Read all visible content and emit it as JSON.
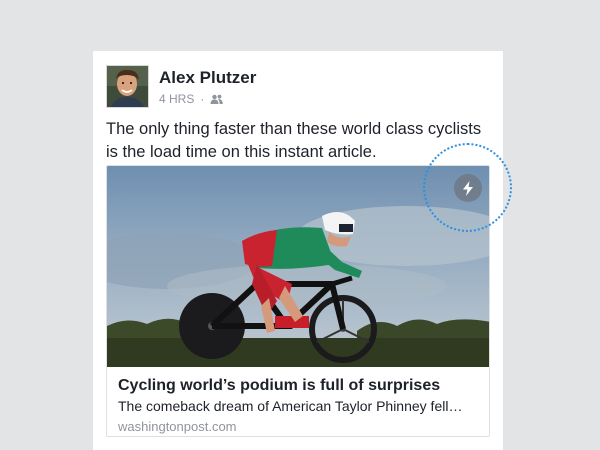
{
  "post": {
    "author_name": "Alex Plutzer",
    "timestamp": "4 HRS",
    "separator": "·",
    "audience_icon": "friends-icon",
    "text": "The only thing faster than these world class cyclists is the load time on this instant article."
  },
  "link_preview": {
    "title": "Cycling world’s podium is full of surprises",
    "description": "The comeback dream of American Taylor Phinney fell…",
    "domain": "washingtonpost.com",
    "image": "cyclist-time-trial-photo"
  },
  "instant_article": {
    "icon": "lightning-bolt-icon",
    "highlight_color": "#2f8fe0"
  },
  "colors": {
    "background": "#e3e4e6",
    "card": "#ffffff",
    "text_primary": "#1d2129",
    "text_secondary": "#90949c"
  }
}
